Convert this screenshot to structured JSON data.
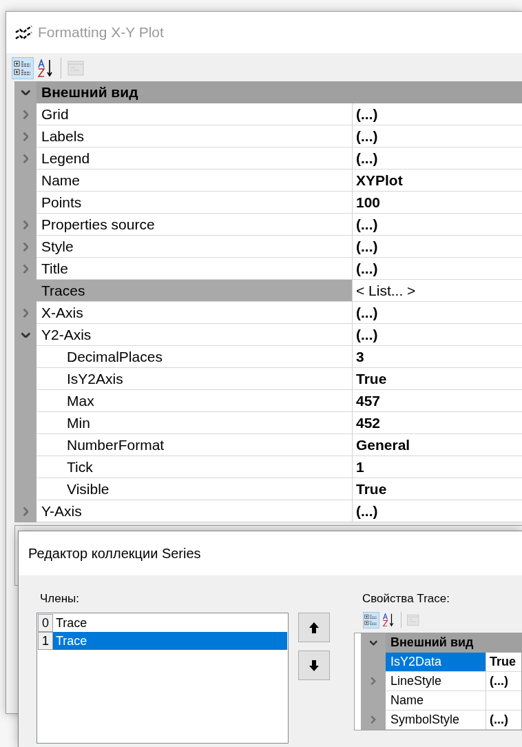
{
  "window": {
    "title": "Formatting X-Y Plot"
  },
  "toolbar": [
    {
      "kind": "categorized",
      "selected": true,
      "disabled": false
    },
    {
      "kind": "alphabetical",
      "selected": false,
      "disabled": false
    },
    {
      "kind": "pages",
      "selected": false,
      "disabled": true
    }
  ],
  "property_grid": {
    "category": "Внешний вид",
    "expanded": true,
    "properties": [
      {
        "name": "Grid",
        "value": "(...)",
        "expanded": false,
        "modified": true,
        "selected": false
      },
      {
        "name": "Labels",
        "value": "(...)",
        "expanded": false,
        "modified": true,
        "selected": false
      },
      {
        "name": "Legend",
        "value": "(...)",
        "expanded": false,
        "modified": true,
        "selected": false
      },
      {
        "name": "Name",
        "value": "XYPlot",
        "modified": true,
        "selected": false
      },
      {
        "name": "Points",
        "value": "100",
        "modified": true,
        "selected": false
      },
      {
        "name": "Properties source",
        "value": "(...)",
        "expanded": false,
        "modified": true,
        "selected": false
      },
      {
        "name": "Style",
        "value": "(...)",
        "expanded": false,
        "modified": true,
        "selected": false
      },
      {
        "name": "Title",
        "value": "(...)",
        "expanded": false,
        "modified": true,
        "selected": false
      },
      {
        "name": "Traces",
        "value": "< List... >",
        "modified": false,
        "selected": true
      },
      {
        "name": "X-Axis",
        "value": "(...)",
        "expanded": false,
        "modified": true,
        "selected": false
      },
      {
        "name": "Y2-Axis",
        "value": "(...)",
        "expanded": true,
        "modified": true,
        "selected": false,
        "children": [
          {
            "name": "DecimalPlaces",
            "value": "3",
            "modified": true,
            "selected": false
          },
          {
            "name": "IsY2Axis",
            "value": "True",
            "modified": true,
            "selected": false
          },
          {
            "name": "Max",
            "value": "457",
            "modified": true,
            "selected": false
          },
          {
            "name": "Min",
            "value": "452",
            "modified": true,
            "selected": false
          },
          {
            "name": "NumberFormat",
            "value": "General",
            "modified": true,
            "selected": false
          },
          {
            "name": "Tick",
            "value": "1",
            "modified": true,
            "selected": false
          },
          {
            "name": "Visible",
            "value": "True",
            "modified": true,
            "selected": false
          }
        ]
      },
      {
        "name": "Y-Axis",
        "value": "(...)",
        "expanded": false,
        "modified": true,
        "selected": false
      }
    ]
  },
  "collection_editor": {
    "title": "Редактор коллекции Series",
    "members_label": "Члены:",
    "members": [
      {
        "index": "0",
        "label": "Trace",
        "selected": false
      },
      {
        "index": "1",
        "label": "Trace",
        "selected": true
      }
    ],
    "properties_label": "Свойства Trace:",
    "toolbar": [
      {
        "kind": "categorized",
        "selected": true,
        "disabled": false
      },
      {
        "kind": "alphabetical",
        "selected": false,
        "disabled": false
      },
      {
        "kind": "pages",
        "selected": false,
        "disabled": true
      }
    ],
    "property_grid": {
      "category": "Внешний вид",
      "expanded": true,
      "properties": [
        {
          "name": "IsY2Data",
          "value": "True",
          "modified": true,
          "selected": true
        },
        {
          "name": "LineStyle",
          "value": "(...)",
          "expanded": false,
          "modified": true,
          "selected": false
        },
        {
          "name": "Name",
          "modified": false,
          "selected": false
        },
        {
          "name": "SymbolStyle",
          "value": "(...)",
          "expanded": false,
          "modified": true,
          "selected": false
        }
      ]
    }
  }
}
